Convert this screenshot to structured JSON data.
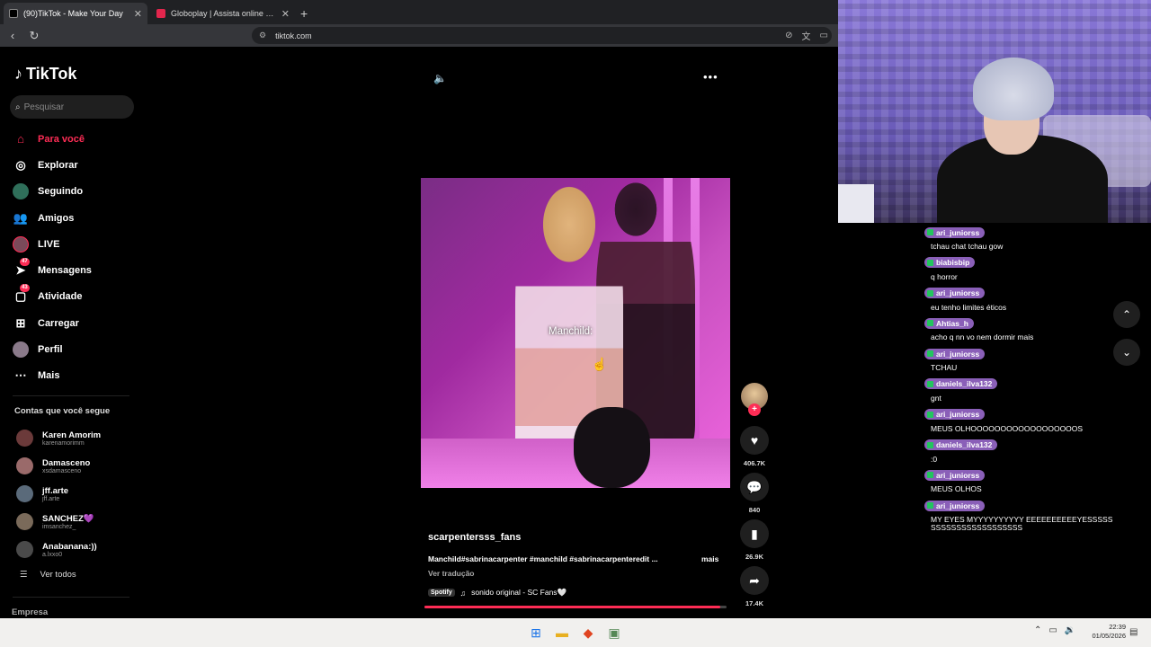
{
  "browser": {
    "tabs": [
      {
        "title": "(90)TikTok - Make Your Day",
        "fav_color": "#000000"
      },
      {
        "title": "Globoplay | Assista online aos progra...",
        "fav_color": "#e2264d"
      }
    ],
    "url": "tiktok.com",
    "new_tab_icon": "plus-icon"
  },
  "tiktok": {
    "brand": "TikTok",
    "search_placeholder": "Pesquisar",
    "nav": [
      {
        "label": "Para você",
        "icon": "home-icon",
        "active": true
      },
      {
        "label": "Explorar",
        "icon": "compass-icon"
      },
      {
        "label": "Seguindo",
        "icon": "following-avatar-icon"
      },
      {
        "label": "Amigos",
        "icon": "friends-icon"
      },
      {
        "label": "LIVE",
        "icon": "live-icon"
      },
      {
        "label": "Mensagens",
        "icon": "messages-icon",
        "badge": "47"
      },
      {
        "label": "Atividade",
        "icon": "activity-icon",
        "badge": "43"
      },
      {
        "label": "Carregar",
        "icon": "upload-icon"
      },
      {
        "label": "Perfil",
        "icon": "profile-icon"
      },
      {
        "label": "Mais",
        "icon": "more-icon"
      }
    ],
    "following_title": "Contas que você segue",
    "following": [
      {
        "name": "Karen Amorim",
        "handle": "karenamorimm"
      },
      {
        "name": "Damasceno",
        "handle": "xsdamasceno"
      },
      {
        "name": "jff.arte",
        "handle": "jff.arte"
      },
      {
        "name": "SANCHEZ💜",
        "handle": "imsanchez_"
      },
      {
        "name": "Anabanana:))",
        "handle": "a.lxxo0"
      }
    ],
    "see_all": "Ver todos",
    "footer": "Empresa"
  },
  "video": {
    "caption_overlay": "Manchild:",
    "username": "scarpentersss_fans",
    "description": "Manchild#sabrinacarpenter #manchild #sabrinacarpenteredit ...",
    "more": "mais",
    "translate": "Ver tradução",
    "spotify": "Spotify",
    "sound": "sonido original - SC Fans🤍",
    "progress": 0.98,
    "likes": "406.7K",
    "comments": "840",
    "saves": "26.9K",
    "shares": "17.4K"
  },
  "chat": [
    {
      "user": "ari_juniorss",
      "text": "tchau chat tchau gow"
    },
    {
      "user": "biabisbip",
      "text": "q horror"
    },
    {
      "user": "ari_juniorss",
      "text": "eu tenho limites éticos"
    },
    {
      "user": "Ahtias_h",
      "text": "acho q nn vo nem dormir mais"
    },
    {
      "user": "ari_juniorss",
      "text": "TCHAU"
    },
    {
      "user": "daniels_ilva132",
      "text": "gnt"
    },
    {
      "user": "ari_juniorss",
      "text": "MEUS OLHOOOOOOOOOOOOOOOOOOS"
    },
    {
      "user": "daniels_ilva132",
      "text": ":0"
    },
    {
      "user": "ari_juniorss",
      "text": "MEUS OLHOS"
    },
    {
      "user": "ari_juniorss",
      "text": "MY EYES MYYYYYYYYYY EEEEEEEEEEYESSSSSSSSSSSSSSSSSSSSSSS"
    }
  ],
  "taskbar": {
    "time": "22:39",
    "date": "01/05/2026"
  },
  "colors": {
    "accent": "#fe2c55",
    "chat_user_bg": "#8a5fb8"
  }
}
